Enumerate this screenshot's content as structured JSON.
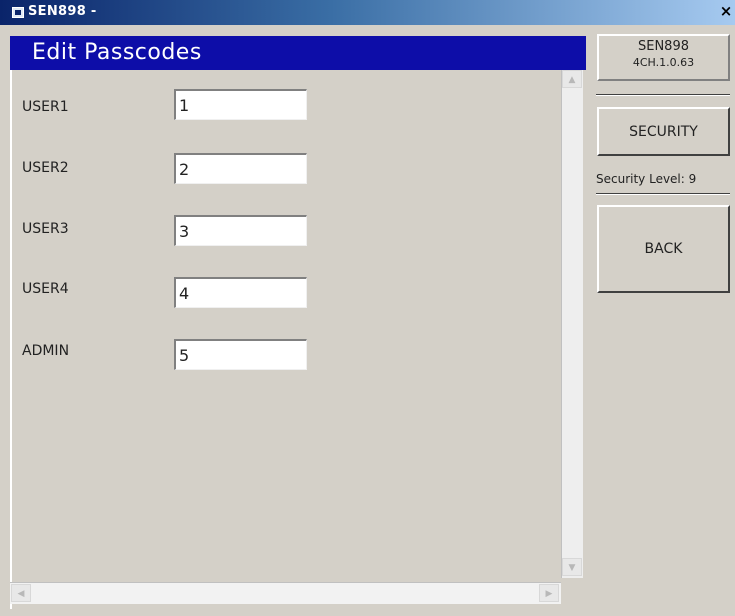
{
  "window": {
    "title": "SEN898 -",
    "close_label": "×"
  },
  "header": {
    "title": "Edit Passcodes"
  },
  "fields": [
    {
      "label": "USER1",
      "value": "1"
    },
    {
      "label": "USER2",
      "value": "2"
    },
    {
      "label": "USER3",
      "value": "3"
    },
    {
      "label": "USER4",
      "value": "4"
    },
    {
      "label": "ADMIN",
      "value": "5"
    }
  ],
  "info": {
    "device": "SEN898",
    "version": "4CH.1.0.63"
  },
  "sidebar": {
    "security_label": "SECURITY",
    "security_level": "Security Level: 9",
    "back_label": "BACK"
  },
  "scrollbar": {
    "up_arrow": "▲",
    "down_arrow": "▼",
    "left_arrow": "◀",
    "right_arrow": "▶"
  },
  "colors": {
    "header_bg": "#0d0da8",
    "panel_bg": "#d4d0c8",
    "titlebar": "#0a246a"
  }
}
